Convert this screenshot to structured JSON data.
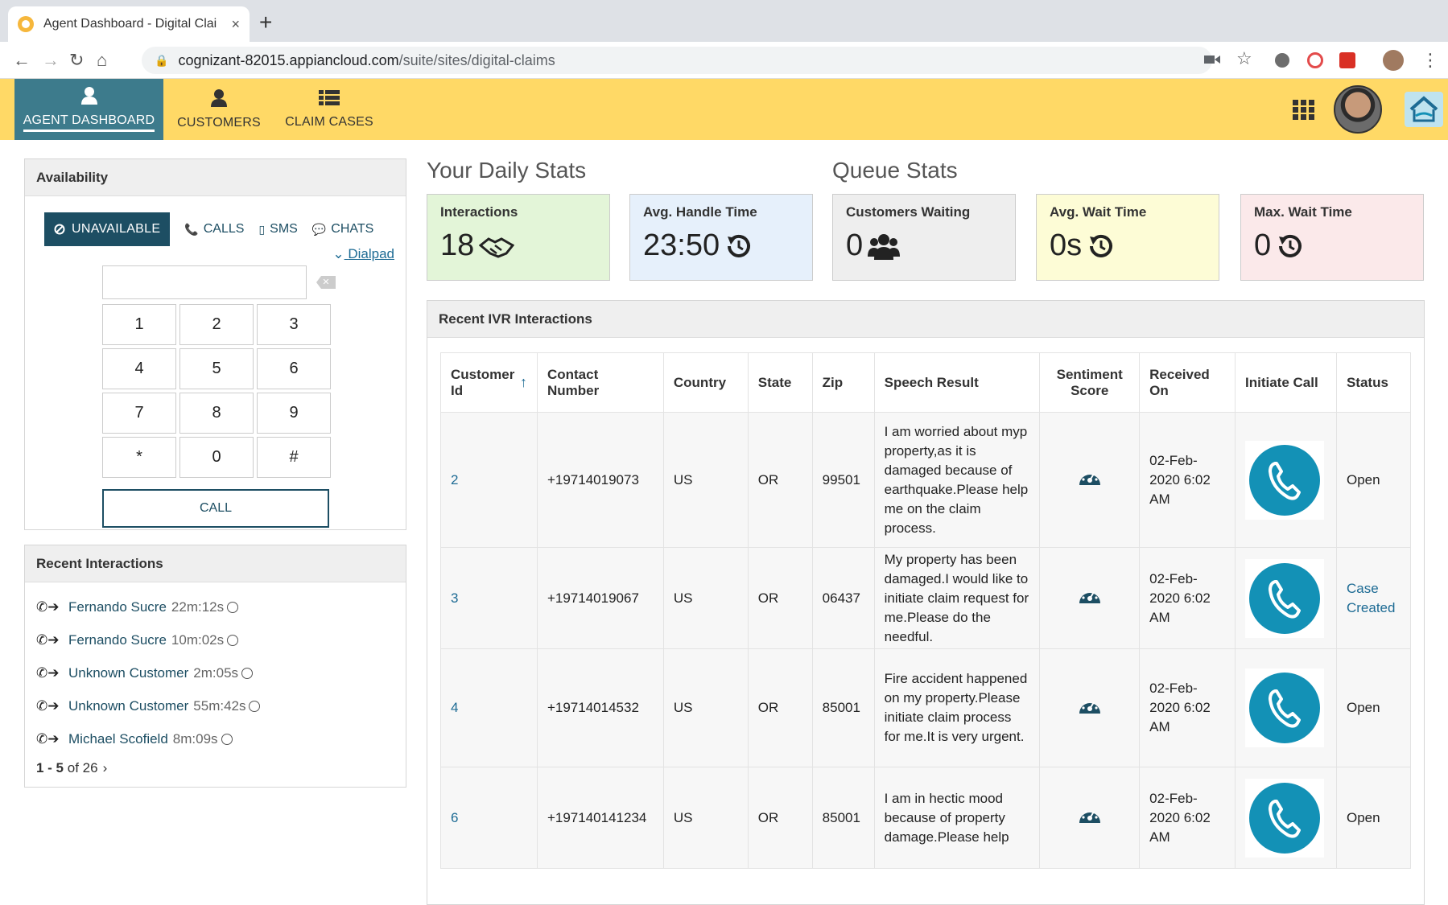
{
  "browser": {
    "tab_title": "Agent Dashboard - Digital Clai",
    "tab_close": "×",
    "new_tab": "+",
    "url_host": "cognizant-82015.appiancloud.com",
    "url_path": "/suite/sites/digital-claims"
  },
  "nav": {
    "items": [
      {
        "label": "AGENT DASHBOARD",
        "icon": "user-icon"
      },
      {
        "label": "CUSTOMERS",
        "icon": "user-icon"
      },
      {
        "label": "CLAIM CASES",
        "icon": "list-icon"
      }
    ],
    "accent": "#ffd966",
    "active_color": "#3d7b8c"
  },
  "availability": {
    "title": "Availability",
    "unavailable_label": "UNAVAILABLE",
    "calls_label": "CALLS",
    "sms_label": "SMS",
    "chats_label": "CHATS",
    "dialpad_label": "Dialpad",
    "keys": [
      "1",
      "2",
      "3",
      "4",
      "5",
      "6",
      "7",
      "8",
      "9",
      "*",
      "0",
      "#"
    ],
    "call_label": "CALL"
  },
  "recent_interactions": {
    "title": "Recent Interactions",
    "items": [
      {
        "name": "Fernando Sucre",
        "duration": "22m:12s"
      },
      {
        "name": "Fernando Sucre",
        "duration": "10m:02s"
      },
      {
        "name": "Unknown Customer",
        "duration": "2m:05s"
      },
      {
        "name": "Unknown Customer",
        "duration": "55m:42s"
      },
      {
        "name": "Michael Scofield",
        "duration": "8m:09s"
      }
    ],
    "pager_range": "1 - 5",
    "pager_total": "of 26"
  },
  "daily_stats": {
    "title": "Your Daily Stats",
    "cards": [
      {
        "label": "Interactions",
        "value": "18",
        "icon": "handshake-icon",
        "bg": "#e3f5d8"
      },
      {
        "label": "Avg. Handle Time",
        "value": "23:50",
        "icon": "history-icon",
        "bg": "#e6f0fb"
      }
    ]
  },
  "queue_stats": {
    "title": "Queue Stats",
    "cards": [
      {
        "label": "Customers Waiting",
        "value": "0",
        "icon": "users-icon",
        "bg": "#eeeeee"
      },
      {
        "label": "Avg. Wait Time",
        "value": "0s",
        "icon": "history-icon",
        "bg": "#fdfcd6"
      },
      {
        "label": "Max. Wait Time",
        "value": "0",
        "icon": "history-icon",
        "bg": "#fbe9ea"
      }
    ]
  },
  "ivr": {
    "title": "Recent IVR Interactions",
    "columns": [
      "Customer Id",
      "Contact Number",
      "Country",
      "State",
      "Zip",
      "Speech Result",
      "Sentiment Score",
      "Received On",
      "Initiate Call",
      "Status"
    ],
    "rows": [
      {
        "id": "2",
        "contact": "+19714019073",
        "country": "US",
        "state": "OR",
        "zip": "99501",
        "speech": "I am worried about myp property,as it is damaged because of earthquake.Please help me on the claim process.",
        "received": "02-Feb-2020 6:02 AM",
        "status": "Open",
        "status_link": false
      },
      {
        "id": "3",
        "contact": "+19714019067",
        "country": "US",
        "state": "OR",
        "zip": "06437",
        "speech": "My property has been damaged.I would like to initiate claim request for me.Please do the needful.",
        "received": "02-Feb-2020 6:02 AM",
        "status": "Case Created",
        "status_link": true
      },
      {
        "id": "4",
        "contact": "+19714014532",
        "country": "US",
        "state": "OR",
        "zip": "85001",
        "speech": "Fire accident happened on my property.Please initiate claim process for me.It is very urgent.",
        "received": "02-Feb-2020 6:02 AM",
        "status": "Open",
        "status_link": false
      },
      {
        "id": "6",
        "contact": "+197140141234",
        "country": "US",
        "state": "OR",
        "zip": "85001",
        "speech": "I am in hectic mood because of property damage.Please help",
        "received": "02-Feb-2020 6:02 AM",
        "status": "Open",
        "status_link": false
      }
    ]
  }
}
